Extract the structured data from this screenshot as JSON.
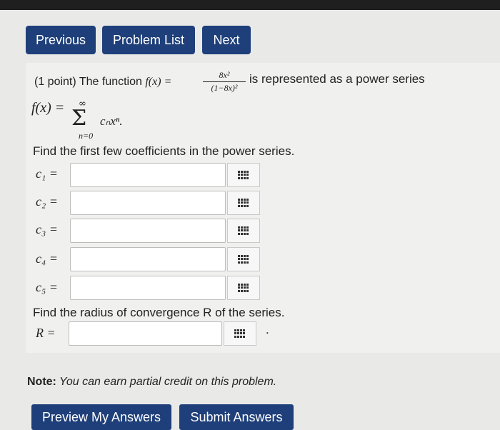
{
  "nav": {
    "previous": "Previous",
    "problem_list": "Problem List",
    "next": "Next"
  },
  "problem": {
    "points": "(1 point) The function",
    "func_lhs": "f(x) =",
    "frac_num": "8x²",
    "frac_den": "(1−8x)²",
    "func_tail": "is represented as a power series",
    "series_lhs": "f(x) =",
    "sum_symbol": "Σ",
    "sum_upper": "∞",
    "sum_lower": "n=0",
    "sum_term": "cₙxⁿ.",
    "prompt_coeffs": "Find the first few coefficients in the power series.",
    "coefficients": [
      {
        "label": "c₁ =",
        "value": ""
      },
      {
        "label": "c₂ =",
        "value": ""
      },
      {
        "label": "c₃ =",
        "value": ""
      },
      {
        "label": "c₄ =",
        "value": ""
      },
      {
        "label": "c₅ =",
        "value": ""
      }
    ],
    "prompt_radius": "Find the radius of convergence R of the series.",
    "radius_label": "R =",
    "radius_value": "",
    "radius_tail": "."
  },
  "note": {
    "bold": "Note:",
    "text": " You can earn partial credit on this problem."
  },
  "actions": {
    "preview": "Preview My Answers",
    "submit": "Submit Answers"
  },
  "colors": {
    "button": "#1e3f7a",
    "panel": "#f0f0ee",
    "background": "#e9e9e7"
  }
}
